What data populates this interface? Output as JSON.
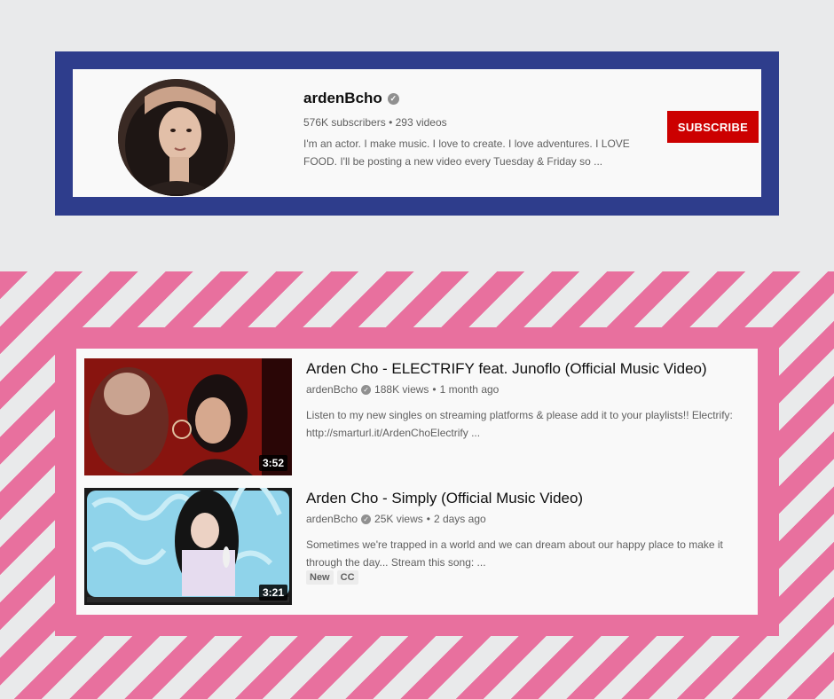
{
  "channel": {
    "name": "ardenBcho",
    "subscribers": "576K subscribers",
    "separator": "•",
    "videos_count": "293 videos",
    "description_line1": "I'm an actor. I make music. I love to create. I love adventures. I LOVE",
    "description_line2": "FOOD. I'll be posting a new video every Tuesday & Friday so ...",
    "subscribe_label": "SUBSCRIBE",
    "verified_icon": "check-circle-icon"
  },
  "videos": [
    {
      "title": "Arden Cho - ELECTRIFY feat. Junoflo (Official Music Video)",
      "channel": "ardenBcho",
      "views": "188K views",
      "age": "1 month ago",
      "description_line1": "Listen to my new singles on streaming platforms & please add it to your playlists!! Electrify:",
      "description_line2": "http://smarturl.it/ArdenChoElectrify ...",
      "duration": "3:52"
    },
    {
      "title": "Arden Cho - Simply (Official Music Video)",
      "channel": "ardenBcho",
      "views": "25K views",
      "age": "2 days ago",
      "description_line1": "Sometimes we're trapped in a world and we can dream about our happy place to make it",
      "description_line2": "through the day... Stream this song: ...",
      "duration": "3:21",
      "badges": [
        "New",
        "CC"
      ]
    }
  ],
  "colors": {
    "frame_blue": "#2e3d8c",
    "frame_pink": "#e8709e",
    "subscribe_red": "#cc0000",
    "background": "#e9eaeb"
  }
}
